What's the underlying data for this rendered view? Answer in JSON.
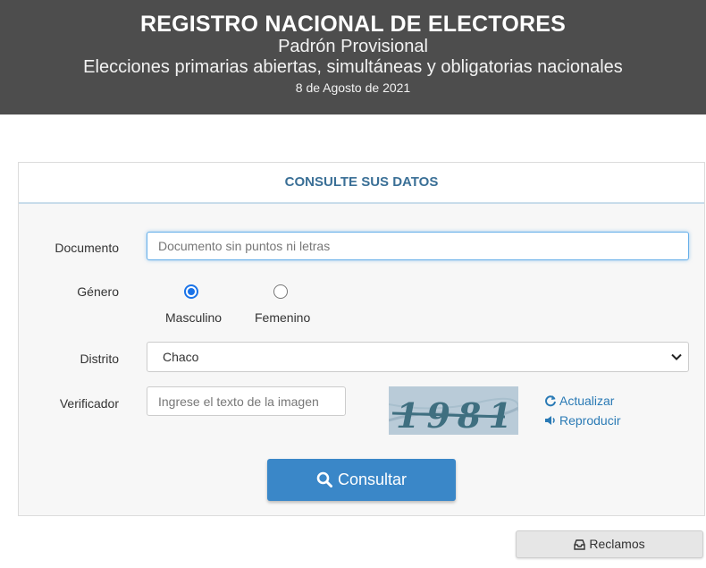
{
  "header": {
    "title": "REGISTRO NACIONAL DE ELECTORES",
    "subtitle": "Padrón Provisional",
    "election": "Elecciones primarias abiertas, simultáneas y obligatorias nacionales",
    "date": "8 de Agosto de 2021"
  },
  "panel": {
    "heading": "CONSULTE SUS DATOS"
  },
  "form": {
    "documento": {
      "label": "Documento",
      "placeholder": "Documento sin puntos ni letras",
      "value": ""
    },
    "genero": {
      "label": "Género",
      "options": [
        {
          "label": "Masculino",
          "checked": true
        },
        {
          "label": "Femenino",
          "checked": false
        }
      ]
    },
    "distrito": {
      "label": "Distrito",
      "selected": "Chaco"
    },
    "verificador": {
      "label": "Verificador",
      "placeholder": "Ingrese el texto de la imagen",
      "captcha_text": "1981",
      "refresh_label": "Actualizar",
      "play_label": "Reproducir"
    },
    "submit_label": "Consultar"
  },
  "footer": {
    "reclamos_label": "Reclamos"
  },
  "colors": {
    "header_bg": "#4d4d4d",
    "accent": "#3a87c8",
    "heading_text": "#3a6f96",
    "link": "#2a7ab5"
  }
}
